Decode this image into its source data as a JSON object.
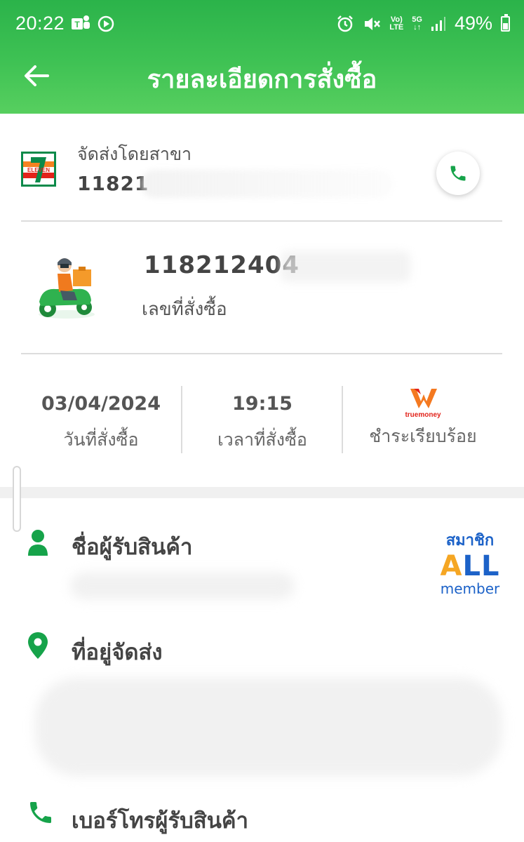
{
  "status_bar": {
    "time": "20:22",
    "volte_top": "Vo)",
    "volte_bottom": "LTE",
    "net_top": "5G",
    "net_bottom": "↓↑",
    "battery": "49%"
  },
  "header": {
    "title": "รายละเอียดการสั่งซื้อ"
  },
  "branch": {
    "caption": "จัดส่งโดยสาขา",
    "number": "11821",
    "logo_text": "ELEVEN"
  },
  "order": {
    "id": "118212404",
    "caption": "เลขที่สั่งซื้อ"
  },
  "info": {
    "date_value": "03/04/2024",
    "date_label": "วันที่สั่งซื้อ",
    "time_value": "19:15",
    "time_label": "เวลาที่สั่งซื้อ",
    "payment_brand": "truemoney",
    "payment_label": "ชำระเรียบร้อย"
  },
  "recipient": {
    "title": "ชื่อผู้รับสินค้า"
  },
  "address": {
    "title": "ที่อยู่จัดส่ง"
  },
  "phone": {
    "title": "เบอร์โทรผู้รับสินค้า"
  },
  "all_member": {
    "top": "สมาชิก",
    "middle": "ALL",
    "bottom": "member"
  },
  "colors": {
    "brand_green": "#2bb34a",
    "icon_green": "#16a34a",
    "all_blue": "#1c62c8"
  }
}
